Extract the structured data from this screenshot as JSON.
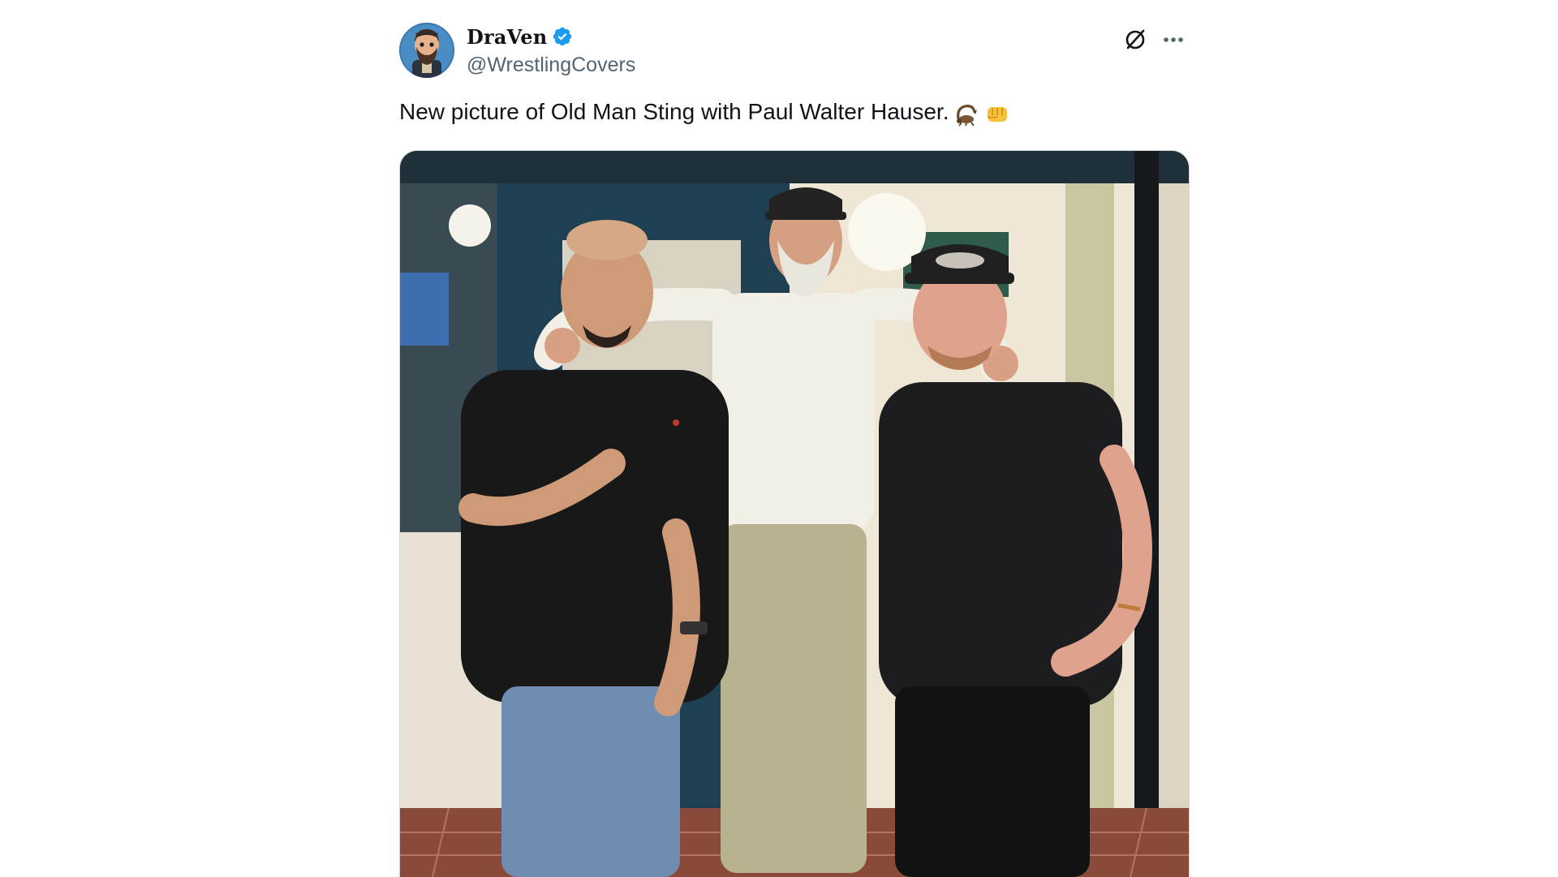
{
  "author": {
    "display_name": "DraVen",
    "handle": "@WrestlingCovers",
    "verified": true,
    "verified_color": "#1d9bf0",
    "avatar_icon": "avatar-cartoon-bearded-man"
  },
  "tweet": {
    "text": "New picture of Old Man Sting with Paul Walter Hauser.",
    "emojis": [
      "scorpion-emoji",
      "fist-bump-emoji"
    ]
  },
  "actions": {
    "grok_icon": "grok-icon",
    "more_icon": "more-icon"
  },
  "media": {
    "type": "photo",
    "subject": "three-men-standing-in-front-of-restaurant"
  },
  "colors": {
    "text_primary": "#0f1419",
    "text_secondary": "#536471",
    "border": "#cfd9de"
  }
}
